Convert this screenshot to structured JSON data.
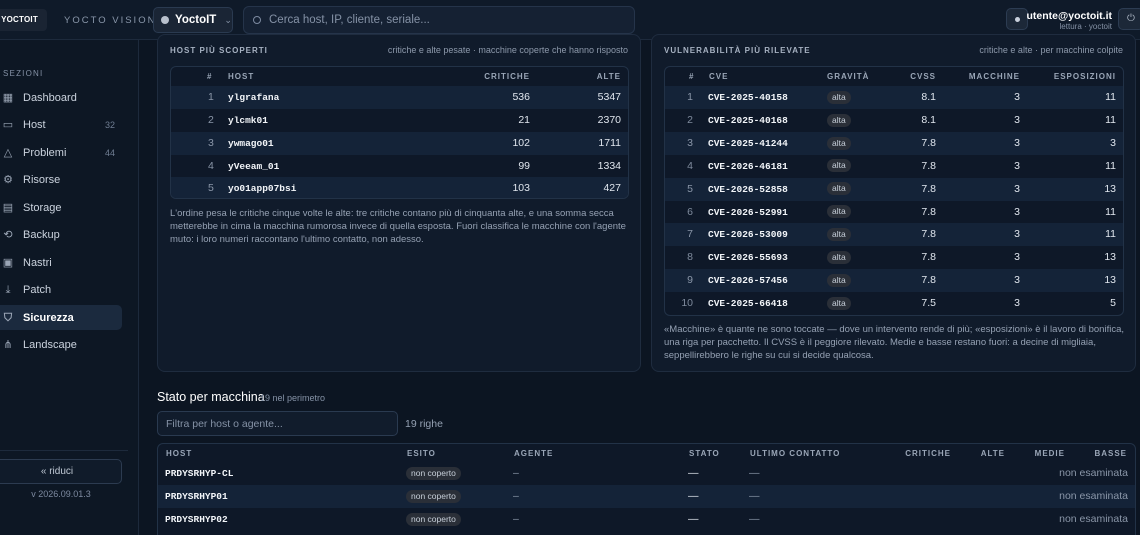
{
  "topbar": {
    "logo_text": "YOCTOIT",
    "brand": "YOCTO VISION",
    "tenant": "YoctoIT",
    "search_placeholder": "Cerca host, IP, cliente, seriale...",
    "user_email": "utente@yoctoit.it",
    "user_role": "lettura · yoctoit"
  },
  "sidebar": {
    "section_title": "SEZIONI",
    "items": [
      {
        "label": "Dashboard",
        "icon": "grid-icon",
        "count": ""
      },
      {
        "label": "Host",
        "icon": "server-icon",
        "count": "32"
      },
      {
        "label": "Problemi",
        "icon": "warning-icon",
        "count": "44"
      },
      {
        "label": "Risorse",
        "icon": "gear-icon",
        "count": ""
      },
      {
        "label": "Storage",
        "icon": "disk-icon",
        "count": ""
      },
      {
        "label": "Backup",
        "icon": "backup-icon",
        "count": ""
      },
      {
        "label": "Nastri",
        "icon": "tape-icon",
        "count": ""
      },
      {
        "label": "Patch",
        "icon": "download-icon",
        "count": ""
      },
      {
        "label": "Sicurezza",
        "icon": "shield-icon",
        "count": "",
        "active": true
      },
      {
        "label": "Landscape",
        "icon": "network-icon",
        "count": ""
      }
    ],
    "collapse_label": "« riduci",
    "version": "v 2026.09.01.3"
  },
  "hosts_panel": {
    "title": "HOST PIÙ SCOPERTI",
    "subtitle": "critiche e alte pesate · macchine coperte che hanno risposto",
    "columns": [
      "#",
      "HOST",
      "CRITICHE",
      "ALTE"
    ],
    "rows": [
      {
        "n": "1",
        "host": "ylgrafana",
        "critiche": "536",
        "alte": "5347"
      },
      {
        "n": "2",
        "host": "ylcmk01",
        "critiche": "21",
        "alte": "2370"
      },
      {
        "n": "3",
        "host": "ywmago01",
        "critiche": "102",
        "alte": "1711"
      },
      {
        "n": "4",
        "host": "yVeeam_01",
        "critiche": "99",
        "alte": "1334"
      },
      {
        "n": "5",
        "host": "yo01app07bsi",
        "critiche": "103",
        "alte": "427"
      }
    ],
    "note": "L'ordine pesa le critiche cinque volte le alte: tre critiche contano più di cinquanta alte, e una somma secca metterebbe in cima la macchina rumorosa invece di quella esposta. Fuori classifica le macchine con l'agente muto: i loro numeri raccontano l'ultimo contatto, non adesso."
  },
  "vuln_panel": {
    "title": "VULNERABILITÀ PIÙ RILEVATE",
    "subtitle": "critiche e alte · per macchine colpite",
    "columns": [
      "#",
      "CVE",
      "GRAVITÀ",
      "CVSS",
      "MACCHINE",
      "ESPOSIZIONI"
    ],
    "rows": [
      {
        "n": "1",
        "cve": "CVE-2025-40158",
        "gravita": "alta",
        "cvss": "8.1",
        "macchine": "3",
        "esposizioni": "11"
      },
      {
        "n": "2",
        "cve": "CVE-2025-40168",
        "gravita": "alta",
        "cvss": "8.1",
        "macchine": "3",
        "esposizioni": "11"
      },
      {
        "n": "3",
        "cve": "CVE-2025-41244",
        "gravita": "alta",
        "cvss": "7.8",
        "macchine": "3",
        "esposizioni": "3"
      },
      {
        "n": "4",
        "cve": "CVE-2026-46181",
        "gravita": "alta",
        "cvss": "7.8",
        "macchine": "3",
        "esposizioni": "11"
      },
      {
        "n": "5",
        "cve": "CVE-2026-52858",
        "gravita": "alta",
        "cvss": "7.8",
        "macchine": "3",
        "esposizioni": "13"
      },
      {
        "n": "6",
        "cve": "CVE-2026-52991",
        "gravita": "alta",
        "cvss": "7.8",
        "macchine": "3",
        "esposizioni": "11"
      },
      {
        "n": "7",
        "cve": "CVE-2026-53009",
        "gravita": "alta",
        "cvss": "7.8",
        "macchine": "3",
        "esposizioni": "11"
      },
      {
        "n": "8",
        "cve": "CVE-2026-55693",
        "gravita": "alta",
        "cvss": "7.8",
        "macchine": "3",
        "esposizioni": "13"
      },
      {
        "n": "9",
        "cve": "CVE-2026-57456",
        "gravita": "alta",
        "cvss": "7.8",
        "macchine": "3",
        "esposizioni": "13"
      },
      {
        "n": "10",
        "cve": "CVE-2025-66418",
        "gravita": "alta",
        "cvss": "7.5",
        "macchine": "3",
        "esposizioni": "5"
      }
    ],
    "note": "«Macchine» è quante ne sono toccate — dove un intervento rende di più; «esposizioni» è il lavoro di bonifica, una riga per pacchetto. Il CVSS è il peggiore rilevato. Medie e basse restano fuori: a decine di migliaia, seppellirebbero le righe su cui si decide qualcosa."
  },
  "machines": {
    "title": "Stato per macchina",
    "count": "19 nel perimetro",
    "filter_placeholder": "Filtra per host o agente...",
    "row_count": "19 righe",
    "columns": [
      "HOST",
      "ESITO",
      "AGENTE",
      "STATO",
      "ULTIMO CONTATTO",
      "CRITICHE",
      "ALTE",
      "MEDIE",
      "BASSE"
    ],
    "rows": [
      {
        "host": "PRDYSRHYP-CL",
        "esito": "non coperto",
        "agente": "–",
        "stato": "—",
        "contatto": "—",
        "basse": "non esaminata"
      },
      {
        "host": "PRDYSRHYP01",
        "esito": "non coperto",
        "agente": "–",
        "stato": "—",
        "contatto": "—",
        "basse": "non esaminata"
      },
      {
        "host": "PRDYSRHYP02",
        "esito": "non coperto",
        "agente": "–",
        "stato": "—",
        "contatto": "—",
        "basse": "non esaminata"
      }
    ]
  },
  "colors": {
    "background": "#0c1522",
    "panel": "#101b2b",
    "accent_active": "#1b2a3e",
    "badge": "#2a2f38"
  }
}
